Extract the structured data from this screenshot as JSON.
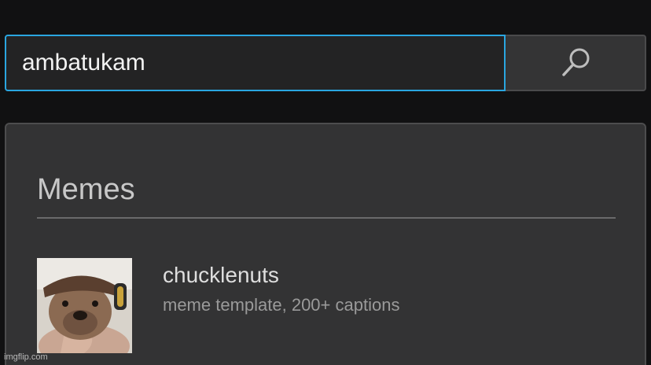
{
  "search": {
    "value": "ambatukam",
    "button_icon": "search-icon",
    "accent_color": "#2aa6e0"
  },
  "results": {
    "section_title": "Memes",
    "items": [
      {
        "title": "chucklenuts",
        "subtitle": "meme template, 200+ captions",
        "thumbnail": "dog-wearing-hat-headphones-image"
      }
    ]
  },
  "watermark": "imgflip.com"
}
